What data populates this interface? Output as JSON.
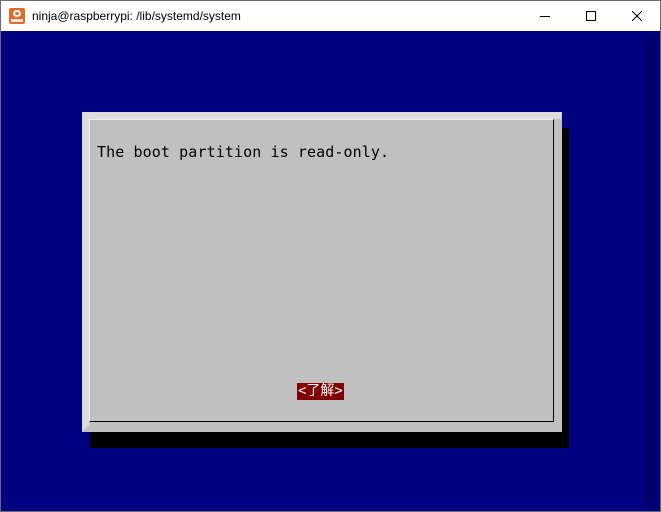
{
  "window": {
    "title": "ninja@raspberrypi: /lib/systemd/system",
    "icon": "terminal-app-icon"
  },
  "dialog": {
    "message": "The boot partition is read-only.",
    "ok_label": "<了解>"
  },
  "colors": {
    "terminal_background": "#000080",
    "dialog_background": "#c0c0c0",
    "button_background": "#800000",
    "button_text": "#ffffff"
  }
}
